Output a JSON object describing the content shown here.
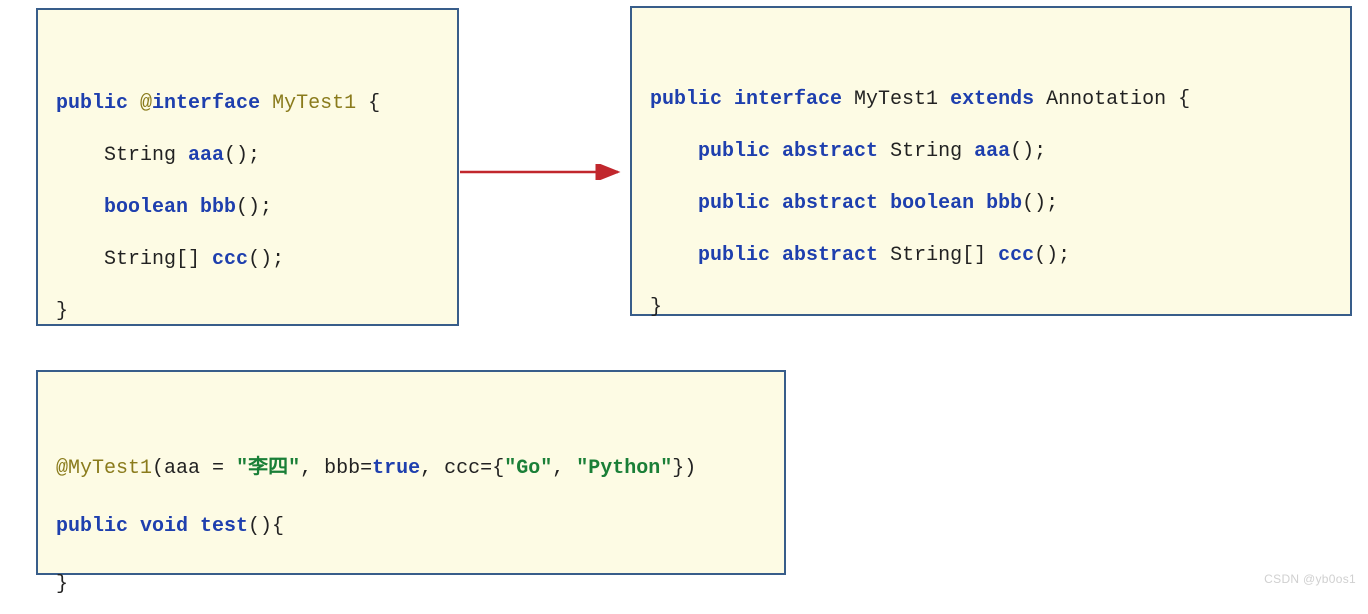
{
  "left": {
    "l1_public": "public",
    "l1_at": "@",
    "l1_interface": "interface",
    "l1_name": " MyTest1 ",
    "l1_brace": "{",
    "l2_type": "String ",
    "l2_fn": "aaa",
    "l2_par": "();",
    "l3_type": "boolean ",
    "l3_fn": "bbb",
    "l3_par": "();",
    "l4_type": "String[] ",
    "l4_fn": "ccc",
    "l4_par": "();",
    "l5": "}"
  },
  "right": {
    "r1_public": "public",
    "r1_interface": " interface",
    "r1_name": " MyTest1",
    "r1_extends": " extends",
    "r1_super": " Annotation ",
    "r1_brace": "{",
    "r2_pub": "public",
    "r2_abs": " abstract",
    "r2_type": " String ",
    "r2_fn": "aaa",
    "r2_par": "();",
    "r3_pub": "public",
    "r3_abs": " abstract",
    "r3_type": " boolean ",
    "r3_fn": "bbb",
    "r3_par": "();",
    "r4_pub": "public",
    "r4_abs": " abstract",
    "r4_type": " String[] ",
    "r4_fn": "ccc",
    "r4_par": "();",
    "r5": "}"
  },
  "bottom": {
    "b1_anno": "@MyTest1",
    "b1_open": "(",
    "b1_aaa": "aaa",
    "b1_eq1": " = ",
    "b1_str1": "\"李四\"",
    "b1_c1": ", ",
    "b1_bbb": "bbb",
    "b1_eq2": "=",
    "b1_true": "true",
    "b1_c2": ", ",
    "b1_ccc": "ccc",
    "b1_eq3": "=",
    "b1_brace": "{",
    "b1_str2": "\"Go\"",
    "b1_c3": ", ",
    "b1_str3": "\"Python\"",
    "b1_close": "})",
    "b2_public": "public",
    "b2_void": " void",
    "b2_name": " test",
    "b2_par": "(){",
    "b3": "}"
  },
  "watermark": "CSDN @yb0os1"
}
